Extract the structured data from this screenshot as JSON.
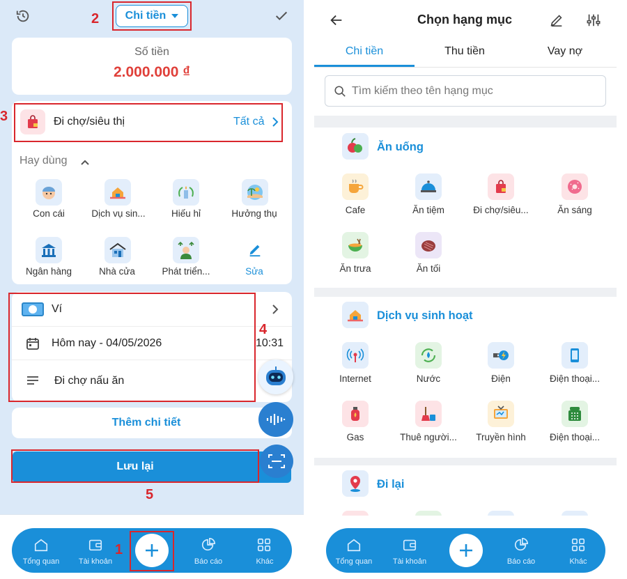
{
  "left": {
    "header": {
      "type_label": "Chi tiền",
      "history_icon": "history-icon",
      "check_icon": "check-icon"
    },
    "amount": {
      "label": "Số tiền",
      "value": "2.000.000 ₫"
    },
    "category": {
      "name": "Đi chợ/siêu thị",
      "all_label": "Tất cả"
    },
    "frequent": {
      "title": "Hay dùng",
      "items": [
        {
          "label": "Con cái"
        },
        {
          "label": "Dịch vụ sin..."
        },
        {
          "label": "Hiếu hỉ"
        },
        {
          "label": "Hưởng thụ"
        },
        {
          "label": "Ngân hàng"
        },
        {
          "label": "Nhà cửa"
        },
        {
          "label": "Phát triển..."
        },
        {
          "label": "Sửa"
        }
      ]
    },
    "details": {
      "wallet": "Ví",
      "date": "Hôm nay - 04/05/2026",
      "time": "10:31",
      "note": "Đi chợ nấu ăn"
    },
    "more_label": "Thêm chi tiết",
    "save_label": "Lưu lại",
    "markers": {
      "m1": "1",
      "m2": "2",
      "m3": "3",
      "m4": "4",
      "m5": "5"
    }
  },
  "right": {
    "header": {
      "title": "Chọn hạng mục"
    },
    "tabs": [
      {
        "label": "Chi tiền"
      },
      {
        "label": "Thu tiền"
      },
      {
        "label": "Vay nợ"
      }
    ],
    "search": {
      "placeholder": "Tìm kiếm theo tên hạng mục"
    },
    "groups": [
      {
        "title": "Ăn uống",
        "items": [
          {
            "label": "Cafe"
          },
          {
            "label": "Ăn tiệm"
          },
          {
            "label": "Đi chợ/siêu..."
          },
          {
            "label": "Ăn sáng"
          },
          {
            "label": "Ăn trưa"
          },
          {
            "label": "Ăn tối"
          }
        ]
      },
      {
        "title": "Dịch vụ sinh hoạt",
        "items": [
          {
            "label": "Internet"
          },
          {
            "label": "Nước"
          },
          {
            "label": "Điện"
          },
          {
            "label": "Điện thoại..."
          },
          {
            "label": "Gas"
          },
          {
            "label": "Thuê người..."
          },
          {
            "label": "Truyền hình"
          },
          {
            "label": "Điện thoại..."
          }
        ]
      },
      {
        "title": "Đi lại",
        "items": []
      }
    ]
  },
  "nav": {
    "items": [
      {
        "label": "Tổng quan"
      },
      {
        "label": "Tài khoản"
      },
      {
        "label": "Báo cáo"
      },
      {
        "label": "Khác"
      }
    ]
  },
  "colors": {
    "primary": "#1a8fd9",
    "amount": "#e0403a",
    "annotation": "#d9262c",
    "nav": "#1a8fd9"
  }
}
